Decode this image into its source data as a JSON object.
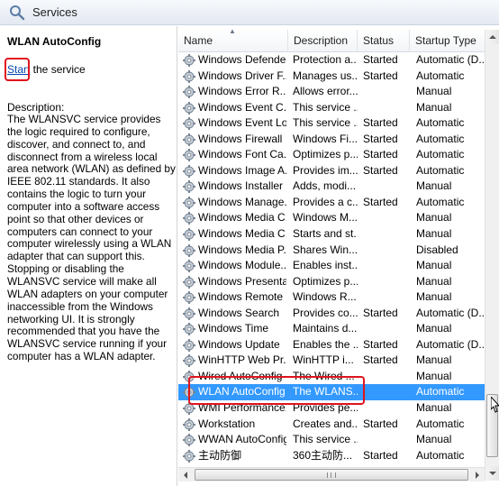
{
  "window": {
    "title": "Services"
  },
  "details": {
    "service_name": "WLAN AutoConfig",
    "start_link": "Start",
    "start_suffix": " the service",
    "description_label": "Description:",
    "description": "The WLANSVC service provides the logic required to configure, discover, and connect to, and disconnect from a wireless local area network (WLAN) as defined by IEEE 802.11 standards. It also contains the logic to turn your computer into a software access point so that other devices or computers can connect to your computer wirelessly using a WLAN adapter that can support this. Stopping or disabling the WLANSVC service will make all WLAN adapters on your computer inaccessible from the Windows networking UI. It is strongly recommended that you have the WLANSVC service running if your computer has a WLAN adapter."
  },
  "columns": {
    "name": "Name",
    "description": "Description",
    "status": "Status",
    "startup": "Startup Type"
  },
  "services": [
    {
      "name": "Windows Defender",
      "description": "Protection a...",
      "status": "Started",
      "startup": "Automatic (D..."
    },
    {
      "name": "Windows Driver F...",
      "description": "Manages us...",
      "status": "Started",
      "startup": "Automatic"
    },
    {
      "name": "Windows Error R...",
      "description": "Allows error...",
      "status": "",
      "startup": "Manual"
    },
    {
      "name": "Windows Event C...",
      "description": "This service ...",
      "status": "",
      "startup": "Manual"
    },
    {
      "name": "Windows Event Log",
      "description": "This service ...",
      "status": "Started",
      "startup": "Automatic"
    },
    {
      "name": "Windows Firewall",
      "description": "Windows Fi...",
      "status": "Started",
      "startup": "Automatic"
    },
    {
      "name": "Windows Font Ca...",
      "description": "Optimizes p...",
      "status": "Started",
      "startup": "Automatic"
    },
    {
      "name": "Windows Image A...",
      "description": "Provides im...",
      "status": "Started",
      "startup": "Automatic"
    },
    {
      "name": "Windows Installer",
      "description": "Adds, modi...",
      "status": "",
      "startup": "Manual"
    },
    {
      "name": "Windows Manage...",
      "description": "Provides a c...",
      "status": "Started",
      "startup": "Automatic"
    },
    {
      "name": "Windows Media C...",
      "description": "Windows M...",
      "status": "",
      "startup": "Manual"
    },
    {
      "name": "Windows Media C...",
      "description": "Starts and st...",
      "status": "",
      "startup": "Manual"
    },
    {
      "name": "Windows Media P...",
      "description": "Shares Win...",
      "status": "",
      "startup": "Disabled"
    },
    {
      "name": "Windows Module...",
      "description": "Enables inst...",
      "status": "",
      "startup": "Manual"
    },
    {
      "name": "Windows Presenta...",
      "description": "Optimizes p...",
      "status": "",
      "startup": "Manual"
    },
    {
      "name": "Windows Remote ...",
      "description": "Windows R...",
      "status": "",
      "startup": "Manual"
    },
    {
      "name": "Windows Search",
      "description": "Provides co...",
      "status": "Started",
      "startup": "Automatic (D..."
    },
    {
      "name": "Windows Time",
      "description": "Maintains d...",
      "status": "",
      "startup": "Manual"
    },
    {
      "name": "Windows Update",
      "description": "Enables the ...",
      "status": "Started",
      "startup": "Automatic (D..."
    },
    {
      "name": "WinHTTP Web Pr...",
      "description": "WinHTTP i...",
      "status": "Started",
      "startup": "Manual"
    },
    {
      "name": "Wired AutoConfig",
      "description": "The Wired ...",
      "status": "",
      "startup": "Manual"
    },
    {
      "name": "WLAN AutoConfig",
      "description": "The WLANS...",
      "status": "",
      "startup": "Automatic"
    },
    {
      "name": "WMI Performance...",
      "description": "Provides pe...",
      "status": "",
      "startup": "Manual"
    },
    {
      "name": "Workstation",
      "description": "Creates and...",
      "status": "Started",
      "startup": "Automatic"
    },
    {
      "name": "WWAN AutoConfig",
      "description": "This service ...",
      "status": "",
      "startup": "Manual"
    },
    {
      "name": "主动防御",
      "description": "360主动防...",
      "status": "Started",
      "startup": "Automatic"
    }
  ],
  "selected_service": "WLAN AutoConfig",
  "colors": {
    "selection": "#3399ff",
    "highlight_box": "#e0141e",
    "link": "#0645ad"
  }
}
